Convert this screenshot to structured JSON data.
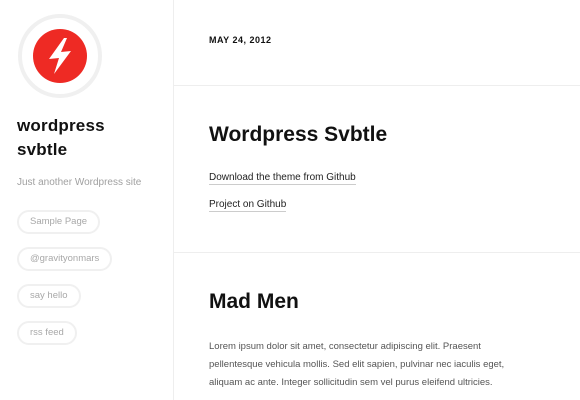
{
  "site": {
    "title_line1": "wordpress",
    "title_line2": "svbtle",
    "tagline": "Just another Wordpress site",
    "logo_icon": "lightning-bolt-icon",
    "accent_color": "#ee2a24"
  },
  "nav": {
    "items": [
      {
        "label": "Sample Page"
      },
      {
        "label": "@gravityonmars"
      },
      {
        "label": "say hello"
      },
      {
        "label": "rss feed"
      }
    ]
  },
  "main": {
    "date": "MAY 24, 2012",
    "posts": [
      {
        "title": "Wordpress Svbtle",
        "links": [
          {
            "label": "Download the theme from Github"
          },
          {
            "label": "Project on Github"
          }
        ]
      },
      {
        "title": "Mad Men",
        "excerpt_lines": [
          "Lorem ipsum dolor sit amet, consectetur adipiscing elit. Praesent",
          "pellentesque vehicula mollis. Sed elit sapien, pulvinar nec iaculis eget,",
          "aliquam ac ante. Integer sollicitudin sem vel purus eleifend ultricies."
        ]
      }
    ]
  }
}
